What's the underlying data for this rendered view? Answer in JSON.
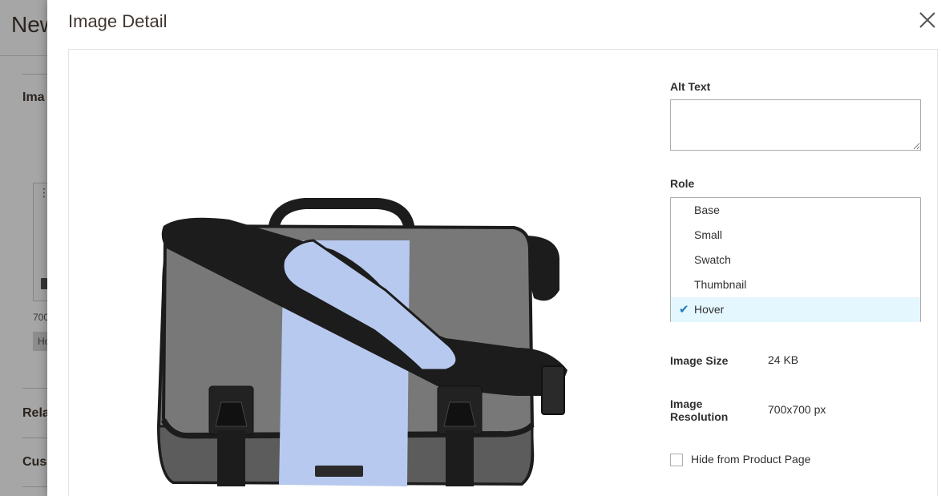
{
  "background": {
    "page_title": "New",
    "sections": [
      "Ima",
      "Rela",
      "Cus"
    ],
    "thumb_text": "700",
    "thumb_tag": "Ho"
  },
  "modal": {
    "title": "Image Detail",
    "alt_text": {
      "label": "Alt Text",
      "value": ""
    },
    "role": {
      "label": "Role",
      "options": [
        {
          "label": "Base",
          "selected": false
        },
        {
          "label": "Small",
          "selected": false
        },
        {
          "label": "Swatch",
          "selected": false
        },
        {
          "label": "Thumbnail",
          "selected": false
        },
        {
          "label": "Hover",
          "selected": true
        }
      ]
    },
    "image_size": {
      "label": "Image Size",
      "value": "24 KB"
    },
    "image_resolution": {
      "label_line1": "Image",
      "label_line2": "Resolution",
      "value": "700x700 px"
    },
    "hide_from_product_page": {
      "label": "Hide from Product Page",
      "checked": false
    }
  },
  "colors": {
    "accent": "#1979c3",
    "selected_bg": "#e5f7fe",
    "bag_gray": "#6b6b6b",
    "bag_blue": "#b7c9ee",
    "bag_black": "#1c1c1c"
  }
}
